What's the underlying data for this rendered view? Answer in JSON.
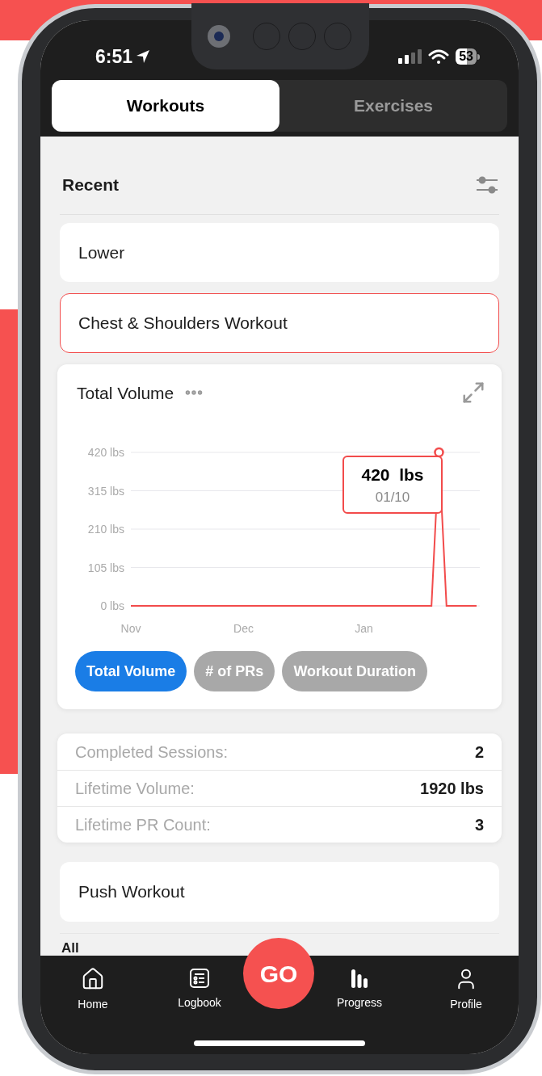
{
  "status_bar": {
    "time": "6:51",
    "battery": "53"
  },
  "tabs": [
    {
      "label": "Workouts",
      "selected": true
    },
    {
      "label": "Exercises",
      "selected": false
    }
  ],
  "recent": {
    "title": "Recent",
    "workouts": [
      {
        "name": "Lower",
        "selected": false
      },
      {
        "name": "Chest & Shoulders Workout",
        "selected": true
      },
      {
        "name": "Push Workout",
        "selected": false
      }
    ]
  },
  "workout_detail": {
    "chart_data": {
      "type": "line",
      "categories": [
        "Nov",
        null,
        null,
        null,
        null,
        null,
        null,
        null,
        null,
        null,
        null,
        null,
        null,
        null,
        null,
        "Dec",
        null,
        null,
        null,
        null,
        null,
        null,
        null,
        null,
        null,
        null,
        null,
        null,
        null,
        null,
        null,
        "Jan",
        null,
        null,
        null,
        null,
        null,
        null,
        null,
        null,
        null,
        null,
        null,
        null,
        null,
        null,
        null
      ],
      "series": [
        {
          "name": "Total Volume",
          "color": "#f24b4b",
          "values": [
            0,
            0,
            0,
            0,
            0,
            0,
            0,
            0,
            0,
            0,
            0,
            0,
            0,
            0,
            0,
            0,
            0,
            0,
            0,
            0,
            0,
            0,
            0,
            0,
            0,
            0,
            0,
            0,
            0,
            0,
            0,
            0,
            0,
            0,
            0,
            0,
            0,
            0,
            0,
            0,
            0,
            420,
            0,
            0,
            0,
            0,
            0
          ]
        }
      ],
      "ylim": [
        0,
        420
      ],
      "grid": true,
      "yticks": [
        {
          "value": 0,
          "label": "0 lbs"
        },
        {
          "value": 105,
          "label": "105 lbs"
        },
        {
          "value": 210,
          "label": "210 lbs"
        },
        {
          "value": 315,
          "label": "315 lbs"
        },
        {
          "value": 420,
          "label": "420 lbs"
        }
      ]
    },
    "tooltip": {
      "value": "420  lbs",
      "date": "01/10"
    },
    "chips": [
      {
        "label": "Total Volume",
        "selected": true
      },
      {
        "label": "# of PRs",
        "selected": false
      },
      {
        "label": "Workout Duration",
        "selected": false
      }
    ],
    "stats": [
      {
        "label": "Completed Sessions:",
        "value": "2"
      },
      {
        "label": "Lifetime Volume:",
        "value": "1920 lbs"
      },
      {
        "label": "Lifetime PR Count:",
        "value": "3"
      }
    ]
  },
  "all_title": "All",
  "go_button": "GO",
  "nav": [
    {
      "label": "Home"
    },
    {
      "label": "Logbook"
    },
    {
      "label": "Progress"
    },
    {
      "label": "Profile"
    }
  ]
}
